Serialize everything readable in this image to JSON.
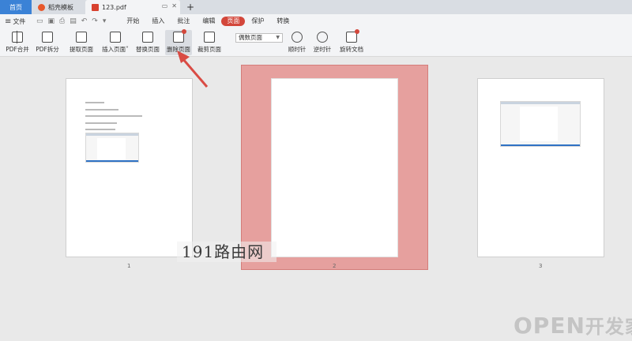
{
  "tabs": {
    "home": "首页",
    "template": "稻壳模板",
    "doc": "123.pdf",
    "new_tab": "+"
  },
  "menubar": {
    "file": "文件",
    "items": [
      "开始",
      "插入",
      "批注",
      "编辑",
      "页面",
      "保护",
      "转换"
    ],
    "active_index": 4
  },
  "ribbon": {
    "buttons": [
      "PDF合并",
      "PDF拆分",
      "提取页面",
      "插入页面",
      "替换页面",
      "删除页面",
      "裁剪页面",
      "顺时针",
      "逆时针",
      "旋转文档"
    ],
    "insert_page_suffix": "˅",
    "page_filter": "偶数页面",
    "selected_button": "删除页面"
  },
  "pages": {
    "labels": [
      "1",
      "2",
      "3"
    ],
    "selected_page": "2"
  },
  "watermarks": {
    "left": "191路由网",
    "right_latin": "OPEN",
    "right_cn": "开发家园"
  },
  "colors": {
    "accent": "#d3473b",
    "selection_fill": "#e6a09e",
    "arrow": "#d94b44",
    "home_tab": "#3b82d6"
  }
}
